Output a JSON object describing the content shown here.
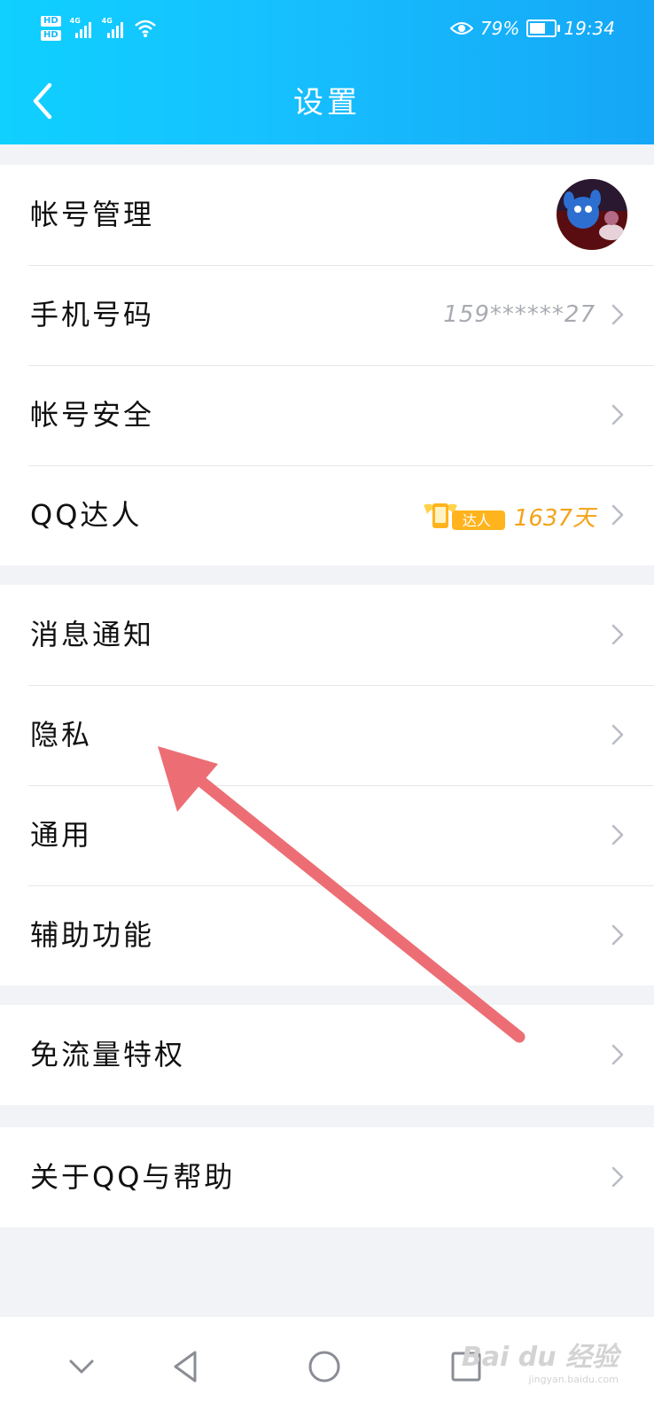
{
  "status_bar": {
    "battery": "79%",
    "battery_level": 0.79,
    "time": "19:34",
    "hd1": "HD",
    "hd2": "HD",
    "net1": "4G",
    "net2": "4G"
  },
  "header": {
    "title": "设置"
  },
  "settings": {
    "account_manage": "帐号管理",
    "phone": {
      "label": "手机号码",
      "value": "159******27"
    },
    "account_security": "帐号安全",
    "qq_daren": {
      "label": "QQ达人",
      "badge": "达人",
      "days": "1637天"
    },
    "notifications": "消息通知",
    "privacy": "隐私",
    "general": "通用",
    "accessibility": "辅助功能",
    "free_data": "免流量特权",
    "about": "关于QQ与帮助"
  },
  "watermark": {
    "brand": "Bai du 经验",
    "url": "jingyan.baidu.com"
  },
  "colors": {
    "header_start": "#0fd0ff",
    "header_end": "#15a6f6",
    "arrow": "#ec6e74",
    "daren": "#f4a21a"
  }
}
